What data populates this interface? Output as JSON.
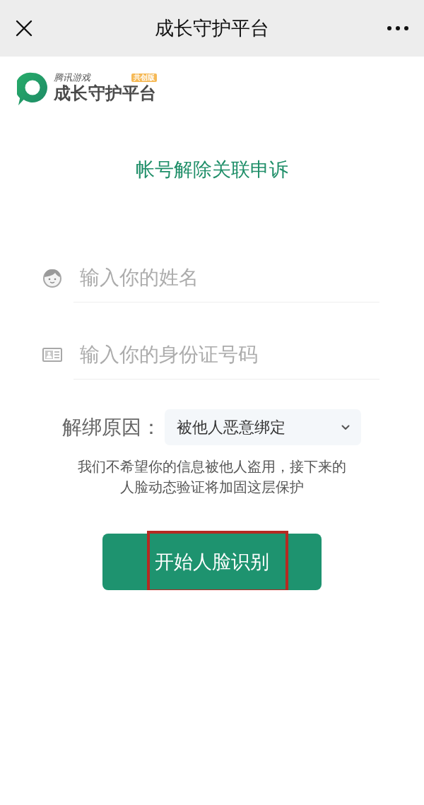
{
  "top_bar": {
    "title": "成长守护平台"
  },
  "logo": {
    "company": "腾讯游戏",
    "badge": "共创版",
    "name": "成长守护平台"
  },
  "heading": "帐号解除关联申诉",
  "fields": [
    {
      "kind": "name",
      "placeholder": "输入你的姓名"
    },
    {
      "kind": "id_card",
      "placeholder": "输入你的身份证号码"
    }
  ],
  "reason": {
    "label": "解绑原因：",
    "value": "被他人恶意绑定"
  },
  "notice": "我们不希望你的信息被他人盗用，接下来的人脸动态验证将加固这层保护",
  "start_button": {
    "label": "开始人脸识别",
    "highlighted": true
  }
}
